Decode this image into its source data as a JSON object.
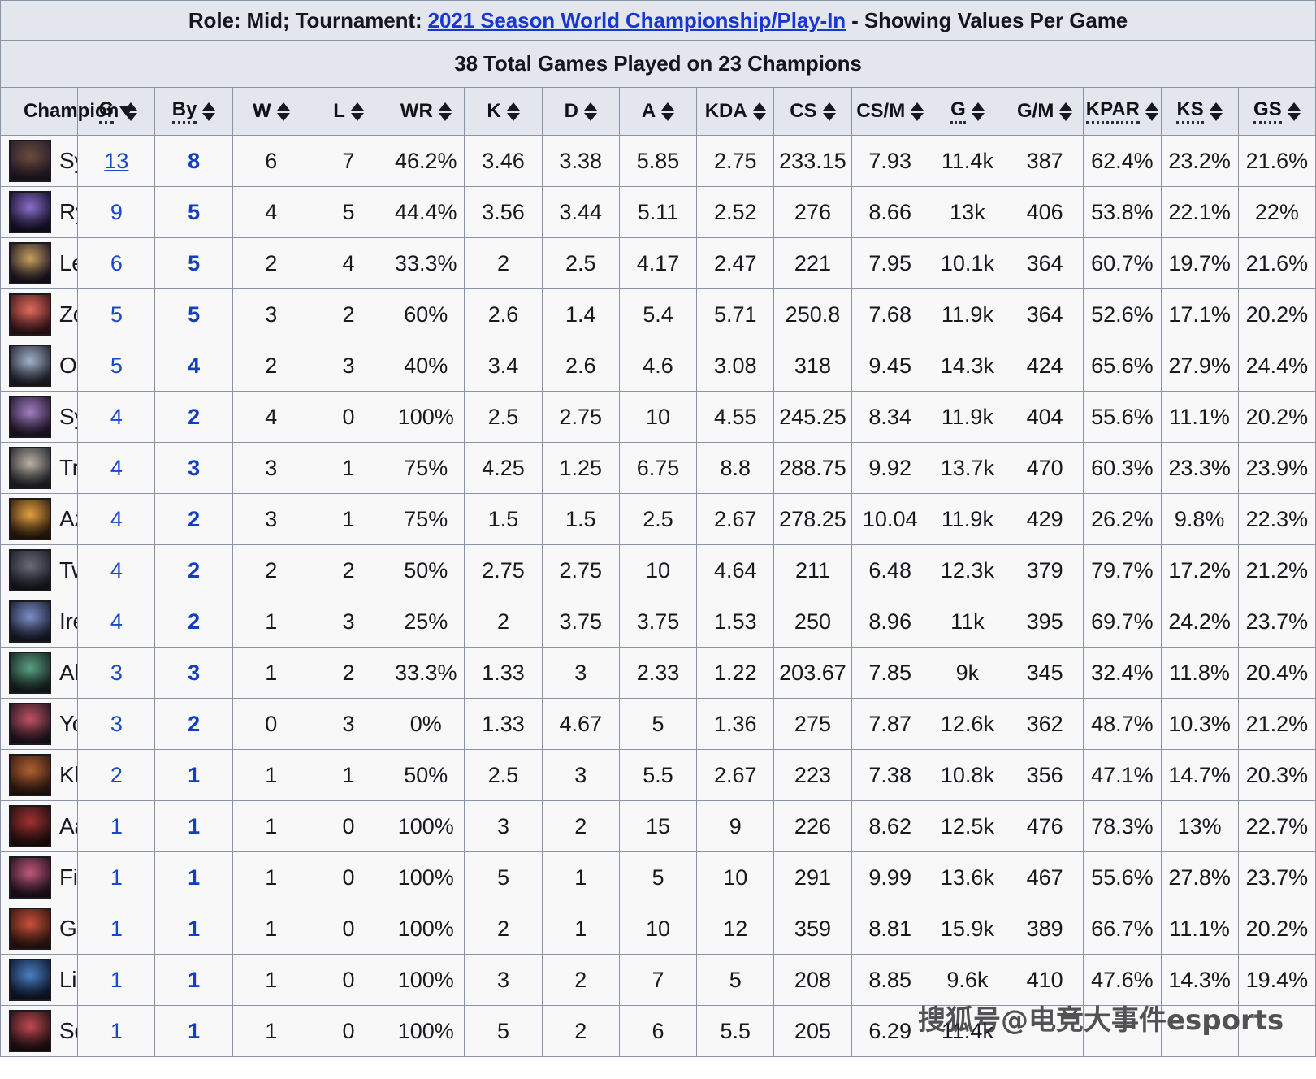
{
  "header": {
    "title_prefix": "Role: Mid; Tournament: ",
    "tournament": "2021 Season World Championship/Play-In",
    "title_suffix": " - Showing Values Per Game",
    "subtitle": "38 Total Games Played on 23 Champions"
  },
  "columns": [
    {
      "label": "Champion",
      "sort": "both",
      "tooltip": false
    },
    {
      "label": "G",
      "sort": "desc",
      "tooltip": true
    },
    {
      "label": "By",
      "sort": "both",
      "tooltip": true
    },
    {
      "label": "W",
      "sort": "both",
      "tooltip": false
    },
    {
      "label": "L",
      "sort": "both",
      "tooltip": false
    },
    {
      "label": "WR",
      "sort": "both",
      "tooltip": false
    },
    {
      "label": "K",
      "sort": "both",
      "tooltip": false
    },
    {
      "label": "D",
      "sort": "both",
      "tooltip": false
    },
    {
      "label": "A",
      "sort": "both",
      "tooltip": false
    },
    {
      "label": "KDA",
      "sort": "both",
      "tooltip": false
    },
    {
      "label": "CS",
      "sort": "both",
      "tooltip": false
    },
    {
      "label": "CS/M",
      "sort": "both",
      "tooltip": false
    },
    {
      "label": "G",
      "sort": "both",
      "tooltip": true
    },
    {
      "label": "G/M",
      "sort": "both",
      "tooltip": false
    },
    {
      "label": "KPAR",
      "sort": "both",
      "tooltip": true
    },
    {
      "label": "KS",
      "sort": "both",
      "tooltip": true
    },
    {
      "label": "GS",
      "sort": "both",
      "tooltip": true
    }
  ],
  "rows": [
    {
      "champion": "Sylas",
      "icon_colors": [
        "#6b4a3a",
        "#2b2030"
      ],
      "g": "13",
      "g_underline": true,
      "by": "8",
      "w": "6",
      "l": "7",
      "wr": "46.2%",
      "k": "3.46",
      "d": "3.38",
      "a": "5.85",
      "kda": "2.75",
      "cs": "233.15",
      "csm": "7.93",
      "gold": "11.4k",
      "gm": "387",
      "kpar": "62.4%",
      "ks": "23.2%",
      "gs": "21.6%"
    },
    {
      "champion": "Ryze",
      "icon_colors": [
        "#8a6ec8",
        "#1b1535"
      ],
      "g": "9",
      "g_underline": false,
      "by": "5",
      "w": "4",
      "l": "5",
      "wr": "44.4%",
      "k": "3.56",
      "d": "3.44",
      "a": "5.11",
      "kda": "2.52",
      "cs": "276",
      "csm": "8.66",
      "gold": "13k",
      "gm": "406",
      "kpar": "53.8%",
      "ks": "22.1%",
      "gs": "22%"
    },
    {
      "champion": "LeBlanc",
      "icon_colors": [
        "#c8a05a",
        "#231a2c"
      ],
      "g": "6",
      "g_underline": false,
      "by": "5",
      "w": "2",
      "l": "4",
      "wr": "33.3%",
      "k": "2",
      "d": "2.5",
      "a": "4.17",
      "kda": "2.47",
      "cs": "221",
      "csm": "7.95",
      "gold": "10.1k",
      "gm": "364",
      "kpar": "60.7%",
      "ks": "19.7%",
      "gs": "21.6%"
    },
    {
      "champion": "Zoe",
      "icon_colors": [
        "#e06b5c",
        "#4a1a20"
      ],
      "g": "5",
      "g_underline": false,
      "by": "5",
      "w": "3",
      "l": "2",
      "wr": "60%",
      "k": "2.6",
      "d": "1.4",
      "a": "5.4",
      "kda": "5.71",
      "cs": "250.8",
      "csm": "7.68",
      "gold": "11.9k",
      "gm": "364",
      "kpar": "52.6%",
      "ks": "17.1%",
      "gs": "20.2%"
    },
    {
      "champion": "Orianna",
      "icon_colors": [
        "#9fb2c8",
        "#2a2a38"
      ],
      "g": "5",
      "g_underline": false,
      "by": "4",
      "w": "2",
      "l": "3",
      "wr": "40%",
      "k": "3.4",
      "d": "2.6",
      "a": "4.6",
      "kda": "3.08",
      "cs": "318",
      "csm": "9.45",
      "gold": "14.3k",
      "gm": "424",
      "kpar": "65.6%",
      "ks": "27.9%",
      "gs": "24.4%"
    },
    {
      "champion": "Syndra",
      "icon_colors": [
        "#a07fc0",
        "#2a1c36"
      ],
      "g": "4",
      "g_underline": false,
      "by": "2",
      "w": "4",
      "l": "0",
      "wr": "100%",
      "k": "2.5",
      "d": "2.75",
      "a": "10",
      "kda": "4.55",
      "cs": "245.25",
      "csm": "8.34",
      "gold": "11.9k",
      "gm": "404",
      "kpar": "55.6%",
      "ks": "11.1%",
      "gs": "20.2%"
    },
    {
      "champion": "Tryndamere",
      "icon_colors": [
        "#b8b0a0",
        "#2e3038"
      ],
      "g": "4",
      "g_underline": false,
      "by": "3",
      "w": "3",
      "l": "1",
      "wr": "75%",
      "k": "4.25",
      "d": "1.25",
      "a": "6.75",
      "kda": "8.8",
      "cs": "288.75",
      "csm": "9.92",
      "gold": "13.7k",
      "gm": "470",
      "kpar": "60.3%",
      "ks": "23.3%",
      "gs": "23.9%"
    },
    {
      "champion": "Azir",
      "icon_colors": [
        "#e0a040",
        "#3a2410"
      ],
      "g": "4",
      "g_underline": false,
      "by": "2",
      "w": "3",
      "l": "1",
      "wr": "75%",
      "k": "1.5",
      "d": "1.5",
      "a": "2.5",
      "kda": "2.67",
      "cs": "278.25",
      "csm": "10.04",
      "gold": "11.9k",
      "gm": "429",
      "kpar": "26.2%",
      "ks": "9.8%",
      "gs": "22.3%"
    },
    {
      "champion": "Twisted Fate",
      "icon_colors": [
        "#6a6a78",
        "#20222c"
      ],
      "g": "4",
      "g_underline": false,
      "by": "2",
      "w": "2",
      "l": "2",
      "wr": "50%",
      "k": "2.75",
      "d": "2.75",
      "a": "10",
      "kda": "4.64",
      "cs": "211",
      "csm": "6.48",
      "gold": "12.3k",
      "gm": "379",
      "kpar": "79.7%",
      "ks": "17.2%",
      "gs": "21.2%"
    },
    {
      "champion": "Irelia",
      "icon_colors": [
        "#7d8ec8",
        "#1e2438"
      ],
      "g": "4",
      "g_underline": false,
      "by": "2",
      "w": "1",
      "l": "3",
      "wr": "25%",
      "k": "2",
      "d": "3.75",
      "a": "3.75",
      "kda": "1.53",
      "cs": "250",
      "csm": "8.96",
      "gold": "11k",
      "gm": "395",
      "kpar": "69.7%",
      "ks": "24.2%",
      "gs": "23.7%"
    },
    {
      "champion": "Akali",
      "icon_colors": [
        "#58a080",
        "#1c2a28"
      ],
      "g": "3",
      "g_underline": false,
      "by": "3",
      "w": "1",
      "l": "2",
      "wr": "33.3%",
      "k": "1.33",
      "d": "3",
      "a": "2.33",
      "kda": "1.22",
      "cs": "203.67",
      "csm": "7.85",
      "gold": "9k",
      "gm": "345",
      "kpar": "32.4%",
      "ks": "11.8%",
      "gs": "20.4%"
    },
    {
      "champion": "Yone",
      "icon_colors": [
        "#c05060",
        "#2a1a28"
      ],
      "g": "3",
      "g_underline": false,
      "by": "2",
      "w": "0",
      "l": "3",
      "wr": "0%",
      "k": "1.33",
      "d": "4.67",
      "a": "5",
      "kda": "1.36",
      "cs": "275",
      "csm": "7.87",
      "gold": "12.6k",
      "gm": "362",
      "kpar": "48.7%",
      "ks": "10.3%",
      "gs": "21.2%"
    },
    {
      "champion": "Kled",
      "icon_colors": [
        "#b06030",
        "#3a1e14"
      ],
      "g": "2",
      "g_underline": false,
      "by": "1",
      "w": "1",
      "l": "1",
      "wr": "50%",
      "k": "2.5",
      "d": "3",
      "a": "5.5",
      "kda": "2.67",
      "cs": "223",
      "csm": "7.38",
      "gold": "10.8k",
      "gm": "356",
      "kpar": "47.1%",
      "ks": "14.7%",
      "gs": "20.3%"
    },
    {
      "champion": "Aatrox",
      "icon_colors": [
        "#a03030",
        "#2a1012"
      ],
      "g": "1",
      "g_underline": false,
      "by": "1",
      "w": "1",
      "l": "0",
      "wr": "100%",
      "k": "3",
      "d": "2",
      "a": "15",
      "kda": "9",
      "cs": "226",
      "csm": "8.62",
      "gold": "12.5k",
      "gm": "476",
      "kpar": "78.3%",
      "ks": "13%",
      "gs": "22.7%"
    },
    {
      "champion": "Fiora",
      "icon_colors": [
        "#c05878",
        "#2a1624"
      ],
      "g": "1",
      "g_underline": false,
      "by": "1",
      "w": "1",
      "l": "0",
      "wr": "100%",
      "k": "5",
      "d": "1",
      "a": "5",
      "kda": "10",
      "cs": "291",
      "csm": "9.99",
      "gold": "13.6k",
      "gm": "467",
      "kpar": "55.6%",
      "ks": "27.8%",
      "gs": "23.7%"
    },
    {
      "champion": "Gragas",
      "icon_colors": [
        "#c85038",
        "#3a1a14"
      ],
      "g": "1",
      "g_underline": false,
      "by": "1",
      "w": "1",
      "l": "0",
      "wr": "100%",
      "k": "2",
      "d": "1",
      "a": "10",
      "kda": "12",
      "cs": "359",
      "csm": "8.81",
      "gold": "15.9k",
      "gm": "389",
      "kpar": "66.7%",
      "ks": "11.1%",
      "gs": "20.2%"
    },
    {
      "champion": "Lissandra",
      "icon_colors": [
        "#4a7ec0",
        "#121e38"
      ],
      "g": "1",
      "g_underline": false,
      "by": "1",
      "w": "1",
      "l": "0",
      "wr": "100%",
      "k": "3",
      "d": "2",
      "a": "7",
      "kda": "5",
      "cs": "208",
      "csm": "8.85",
      "gold": "9.6k",
      "gm": "410",
      "kpar": "47.6%",
      "ks": "14.3%",
      "gs": "19.4%"
    },
    {
      "champion": "Sett",
      "icon_colors": [
        "#c04850",
        "#2a1418"
      ],
      "g": "1",
      "g_underline": false,
      "by": "1",
      "w": "1",
      "l": "0",
      "wr": "100%",
      "k": "5",
      "d": "2",
      "a": "6",
      "kda": "5.5",
      "cs": "205",
      "csm": "6.29",
      "gold": "11.4k",
      "gm": "",
      "kpar": "",
      "ks": "",
      "gs": ""
    }
  ],
  "watermark": "搜狐号@电竞大事件esports"
}
